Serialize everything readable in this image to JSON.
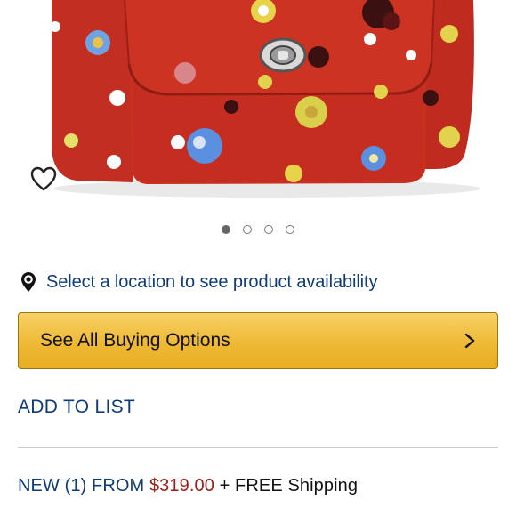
{
  "product": {
    "image_alt": "Red floral print leather backpack",
    "gallery_count": 4,
    "gallery_active_index": 0
  },
  "location": {
    "icon": "location-pin-icon",
    "text": "Select a location to see product availability"
  },
  "buying_options": {
    "label": "See All Buying Options",
    "icon": "chevron-right-icon"
  },
  "add_to_list": {
    "label": "ADD TO LIST"
  },
  "offer": {
    "prefix": "NEW (1) FROM ",
    "price": "$319.00",
    "suffix": " + FREE Shipping"
  },
  "colors": {
    "link": "#0f3b7a",
    "price": "#a11d17",
    "button": "#eeb935",
    "bag": "#c22e22"
  }
}
